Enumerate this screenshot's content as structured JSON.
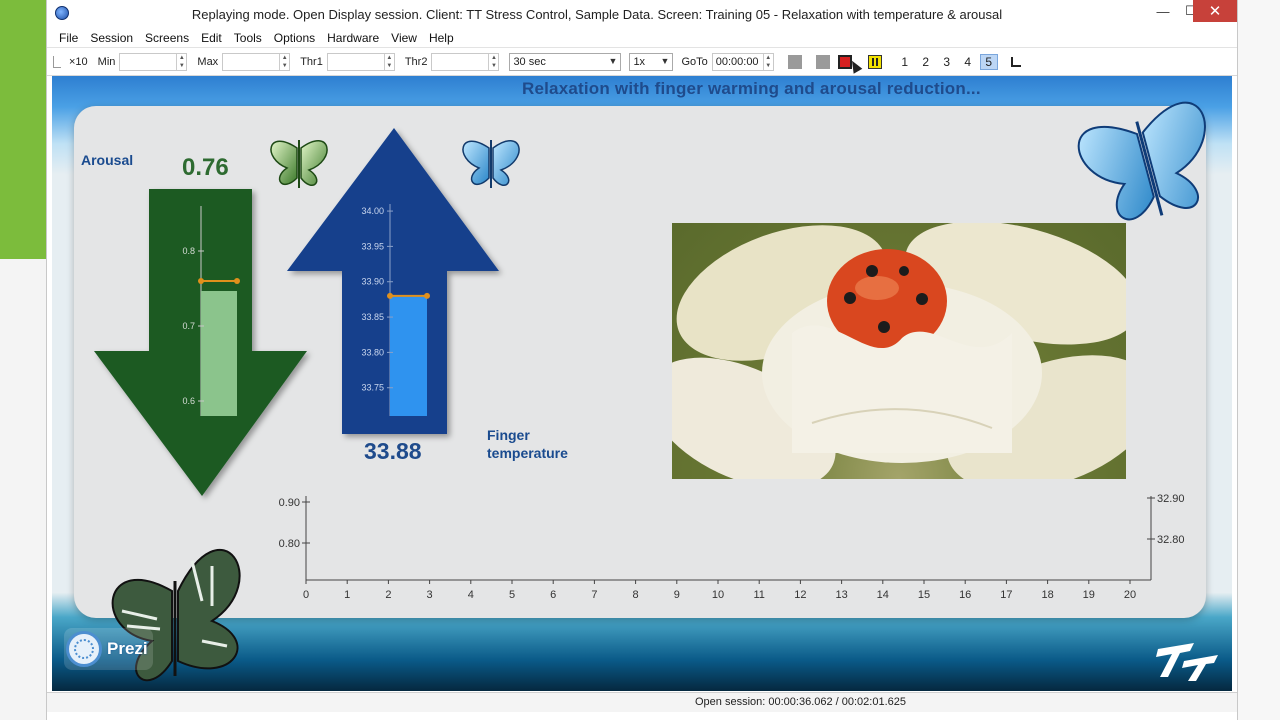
{
  "window": {
    "title": "Replaying mode. Open Display session. Client: TT Stress Control, Sample Data. Screen: Training 05 - Relaxation with temperature & arousal",
    "close_glyph": "✕",
    "min_glyph": "—",
    "max_glyph": "☐"
  },
  "menu": [
    "File",
    "Session",
    "Screens",
    "Edit",
    "Tools",
    "Options",
    "Hardware",
    "View",
    "Help"
  ],
  "toolbar": {
    "x10": "×10",
    "min_label": "Min",
    "min_value": "",
    "max_label": "Max",
    "max_value": "",
    "thr1_label": "Thr1",
    "thr1_value": "",
    "thr2_label": "Thr2",
    "thr2_value": "",
    "period": "30 sec",
    "speed": "1x",
    "goto_label": "GoTo",
    "goto_value": "00:00:00",
    "screen_numbers": [
      "1",
      "2",
      "3",
      "4",
      "5"
    ],
    "active_screen": "5",
    "colors": {
      "record": "#d62020",
      "pause": "#f2e200",
      "active_tab": "#bcd6f5"
    }
  },
  "stage": {
    "title": "Relaxation with finger warming and arousal reduction...",
    "arousal_label": "Arousal",
    "arousal_value": "0.76",
    "temperature_label_1": "Finger",
    "temperature_label_2": "temperature",
    "temperature_value": "33.88",
    "arousal_gauge": {
      "ticks": [
        "0.8",
        "0.7",
        "0.6"
      ],
      "level": 0.76,
      "range": [
        0.58,
        0.86
      ]
    },
    "temperature_gauge": {
      "ticks": [
        "34.00",
        "33.95",
        "33.90",
        "33.85",
        "33.80",
        "33.75"
      ],
      "level": 33.88,
      "range": [
        33.71,
        34.01
      ]
    },
    "graph": {
      "left_ticks": [
        "0.90",
        "0.80"
      ],
      "right_ticks": [
        "32.90",
        "32.80"
      ],
      "x_ticks": [
        "0",
        "1",
        "2",
        "3",
        "4",
        "5",
        "6",
        "7",
        "8",
        "9",
        "10",
        "11",
        "12",
        "13",
        "14",
        "15",
        "16",
        "17",
        "18",
        "19",
        "20"
      ]
    },
    "colors": {
      "arousal_arrow": "#1a5a23",
      "arousal_bar": "#8bc48c",
      "temp_arrow": "#133f8c",
      "temp_bar": "#2f93ef",
      "marker": "#e0901c"
    }
  },
  "prezi": {
    "label": "Prezi"
  },
  "status": {
    "text": "Open session: 00:00:36.062 / 00:02:01.625"
  }
}
